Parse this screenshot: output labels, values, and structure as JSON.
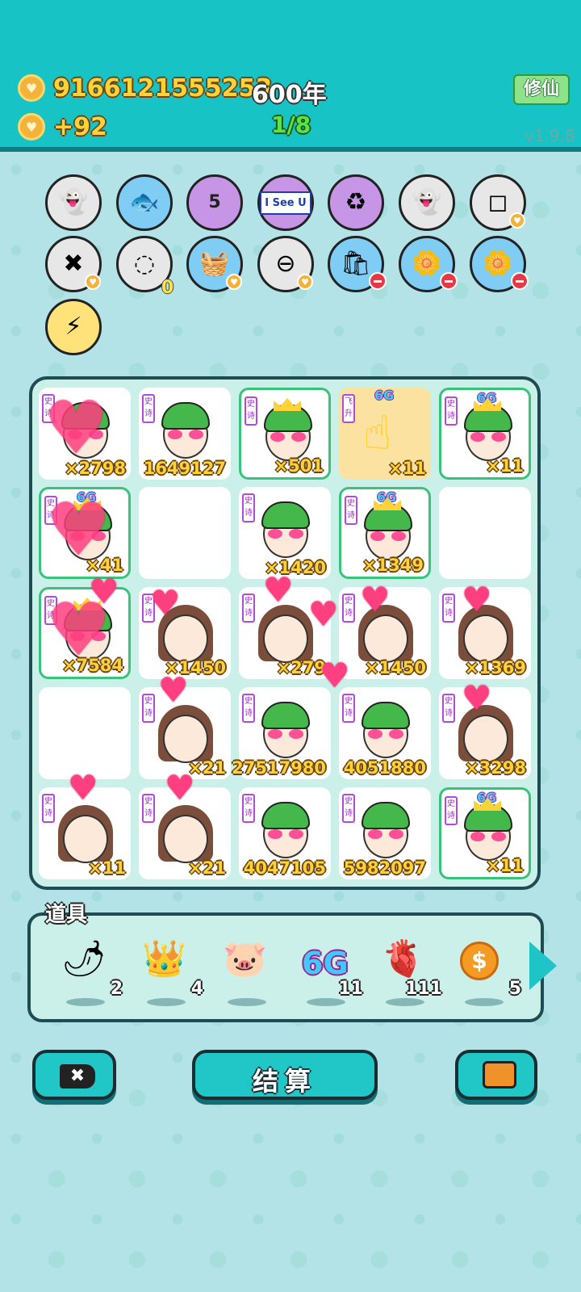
{
  "header": {
    "coins": "9166121555253",
    "years": "600年",
    "income": "+92",
    "level_progress": "1/8",
    "cultivate_button": "修仙",
    "version": "v1.9.8"
  },
  "tools": {
    "row1": [
      {
        "icon": "ghost-icon",
        "glyph": "👻",
        "style": "grey"
      },
      {
        "icon": "fishbowl-icon",
        "glyph": "🐟",
        "style": "blue"
      },
      {
        "icon": "calendar-icon",
        "glyph": "📅",
        "style": "purple",
        "label": "5"
      },
      {
        "icon": "i-see-u-icon",
        "glyph": "",
        "style": "purple",
        "label": "I See U"
      },
      {
        "icon": "recycle-icon",
        "glyph": "♻",
        "style": "purple"
      },
      {
        "icon": "winking-ghost-icon",
        "glyph": "👻",
        "style": "grey"
      },
      {
        "icon": "sugar-cubes-icon",
        "glyph": "◻",
        "style": "grey"
      }
    ],
    "row2": [
      {
        "icon": "remove-tag-icon",
        "glyph": "✖",
        "style": "grey"
      },
      {
        "icon": "egg-tray-icon",
        "glyph": "◌",
        "style": "grey",
        "count": "0"
      },
      {
        "icon": "fruit-basket-icon",
        "glyph": "🧺",
        "style": "blue"
      },
      {
        "icon": "minus-circle-icon",
        "glyph": "⊖",
        "style": "grey"
      },
      {
        "icon": "trash-bag-icon",
        "glyph": "🛍",
        "style": "blue"
      },
      {
        "icon": "flower-pot-icon",
        "glyph": "🌼",
        "style": "blue"
      },
      {
        "icon": "flower-pot-icon",
        "glyph": "🌼",
        "style": "blue"
      }
    ],
    "row3": [
      {
        "icon": "lightning-icon",
        "glyph": "⚡",
        "style": "gold"
      }
    ]
  },
  "board": {
    "tag_text": "史诗",
    "ascend_tag": "飞升",
    "six_g": "6G",
    "cells": [
      {
        "type": "face-hat",
        "count": "×2798",
        "hearted": true
      },
      {
        "type": "face-hat",
        "count": "1649127"
      },
      {
        "type": "face-crown",
        "count": "×501",
        "upgraded": true
      },
      {
        "type": "hand",
        "count": "×11",
        "sixg": true
      },
      {
        "type": "face-crown",
        "count": "×11",
        "upgraded": true,
        "sixg": true
      },
      {
        "type": "face-crown",
        "count": "×41",
        "upgraded": true,
        "sixg": true,
        "hearted": true
      },
      {
        "type": "empty",
        "count": ""
      },
      {
        "type": "face-hat",
        "count": "×1420"
      },
      {
        "type": "face-crown",
        "count": "×1349",
        "upgraded": true,
        "sixg": true
      },
      {
        "type": "empty",
        "count": ""
      },
      {
        "type": "face-crown",
        "count": "×7584",
        "upgraded": true,
        "hearted": true
      },
      {
        "type": "girl",
        "count": "×1450"
      },
      {
        "type": "girl",
        "count": "×279"
      },
      {
        "type": "girl",
        "count": "×1450"
      },
      {
        "type": "girl",
        "count": "×1369"
      },
      {
        "type": "empty",
        "count": ""
      },
      {
        "type": "girl",
        "count": "×21"
      },
      {
        "type": "face-hat",
        "count": "27517980"
      },
      {
        "type": "face-hat",
        "count": "4051880"
      },
      {
        "type": "girl",
        "count": "×3298"
      },
      {
        "type": "girl",
        "count": "×11"
      },
      {
        "type": "girl",
        "count": "×21"
      },
      {
        "type": "face-hat",
        "count": "4047105"
      },
      {
        "type": "face-hat",
        "count": "5982097"
      },
      {
        "type": "face-crown",
        "count": "×11",
        "upgraded": true,
        "sixg": true
      }
    ]
  },
  "items": {
    "label": "道具",
    "list": [
      {
        "icon": "chili-pepper-icon",
        "glyph": "🌶",
        "count": "2"
      },
      {
        "icon": "crown-icon",
        "glyph": "👑",
        "count": "4"
      },
      {
        "icon": "piggy-bank-icon",
        "glyph": "🐷",
        "count": ""
      },
      {
        "icon": "six-g-icon",
        "glyph": "6G",
        "count": "11"
      },
      {
        "icon": "liver-icon",
        "glyph": "🫀",
        "count": "111"
      },
      {
        "icon": "dollar-coin-icon",
        "glyph": "$",
        "count": "5"
      }
    ]
  },
  "buttons": {
    "settle": "结算"
  }
}
